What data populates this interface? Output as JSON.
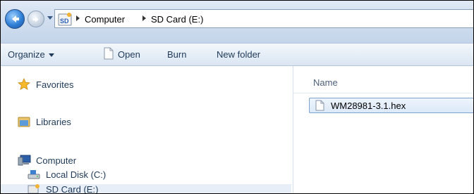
{
  "address": {
    "breadcrumbs": [
      "Computer",
      "SD Card (E:)"
    ]
  },
  "toolbar": {
    "organize": "Organize",
    "open": "Open",
    "burn": "Burn",
    "new_folder": "New folder"
  },
  "nav": {
    "favorites": "Favorites",
    "libraries": "Libraries",
    "computer": "Computer",
    "local_disk": "Local Disk (C:)",
    "sd_card": "SD Card (E:)"
  },
  "content": {
    "column_header": "Name",
    "files": [
      {
        "name": "WM28981-3.1.hex",
        "selected": true
      }
    ]
  },
  "colors": {
    "selection": "#dce9f8",
    "selection_border": "#7da2ce",
    "link_text": "#1e3958"
  }
}
